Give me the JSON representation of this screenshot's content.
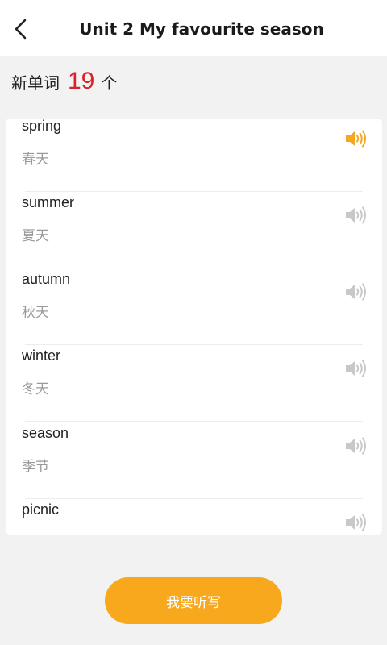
{
  "header": {
    "title": "Unit 2 My favourite season"
  },
  "summary": {
    "label": "新单词",
    "count": "19",
    "unit": "个"
  },
  "words": [
    {
      "word": "spring",
      "meaning": "春天",
      "playing": true
    },
    {
      "word": "summer",
      "meaning": "夏天",
      "playing": false
    },
    {
      "word": "autumn",
      "meaning": "秋天",
      "playing": false
    },
    {
      "word": "winter",
      "meaning": "冬天",
      "playing": false
    },
    {
      "word": "season",
      "meaning": "季节",
      "playing": false
    },
    {
      "word": "picnic",
      "meaning": "",
      "playing": false
    }
  ],
  "action": {
    "label": "我要听写"
  },
  "colors": {
    "accent": "#f8a81c",
    "count": "#d8232a",
    "speaker_active": "#f5a623",
    "speaker_inactive": "#c8c8c8"
  }
}
